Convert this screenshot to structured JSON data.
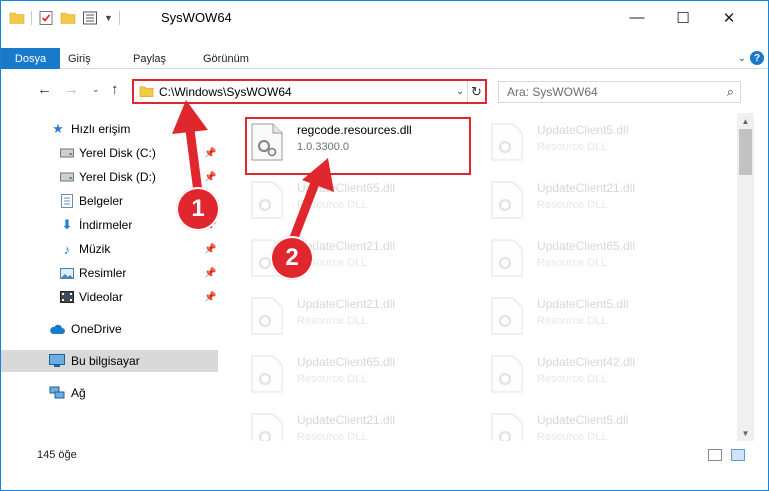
{
  "window": {
    "title": "SysWOW64",
    "controls": {
      "minimize": "—",
      "maximize": "☐",
      "close": "✕"
    }
  },
  "ribbon": {
    "tabs": [
      "Dosya",
      "Giriş",
      "Paylaş",
      "Görünüm"
    ],
    "help": "?"
  },
  "navigation": {
    "address": "C:\\Windows\\SysWOW64",
    "search_placeholder": "Ara: SysWOW64"
  },
  "sidebar": {
    "items": [
      {
        "label": "Hızlı erişim",
        "icon": "star-icon",
        "pinned": false
      },
      {
        "label": "Yerel Disk (C:)",
        "icon": "drive-icon",
        "pinned": true
      },
      {
        "label": "Yerel Disk (D:)",
        "icon": "drive-icon",
        "pinned": true
      },
      {
        "label": "Belgeler",
        "icon": "documents-icon",
        "pinned": true
      },
      {
        "label": "İndirmeler",
        "icon": "download-icon",
        "pinned": true
      },
      {
        "label": "Müzik",
        "icon": "music-icon",
        "pinned": true
      },
      {
        "label": "Resimler",
        "icon": "pictures-icon",
        "pinned": true
      },
      {
        "label": "Videolar",
        "icon": "video-icon",
        "pinned": true
      },
      {
        "label": "OneDrive",
        "icon": "cloud-icon",
        "pinned": false
      },
      {
        "label": "Bu bilgisayar",
        "icon": "computer-icon",
        "pinned": false,
        "selected": true
      },
      {
        "label": "Ağ",
        "icon": "network-icon",
        "pinned": false
      }
    ]
  },
  "files": [
    {
      "name": "regcode.resources.dll",
      "meta": "1.0.3300.0",
      "highlighted": true
    },
    {
      "name": "UpdateClient5.dll",
      "meta": "Resource DLL"
    },
    {
      "name": "UpdateClient65.dll",
      "meta": "Resource DLL"
    },
    {
      "name": "UpdateClient21.dll",
      "meta": "Resource DLL"
    },
    {
      "name": "UpdateClient21.dll",
      "meta": "Resource DLL"
    },
    {
      "name": "UpdateClient65.dll",
      "meta": "Resource DLL"
    },
    {
      "name": "UpdateClient21.dll",
      "meta": "Resource DLL"
    },
    {
      "name": "UpdateClient5.dll",
      "meta": "Resource DLL"
    },
    {
      "name": "UpdateClient65.dll",
      "meta": "Resource DLL"
    },
    {
      "name": "UpdateClient42.dll",
      "meta": "Resource DLL"
    },
    {
      "name": "UpdateClient21.dll",
      "meta": "Resource DLL"
    },
    {
      "name": "UpdateClient5.dll",
      "meta": "Resource DLL"
    }
  ],
  "status": {
    "item_count": "145 öğe"
  },
  "annotations": {
    "step1": "1",
    "step2": "2"
  },
  "colors": {
    "accent": "#1979ca",
    "highlight": "#e0272d",
    "selected": "#d9d9d9"
  }
}
